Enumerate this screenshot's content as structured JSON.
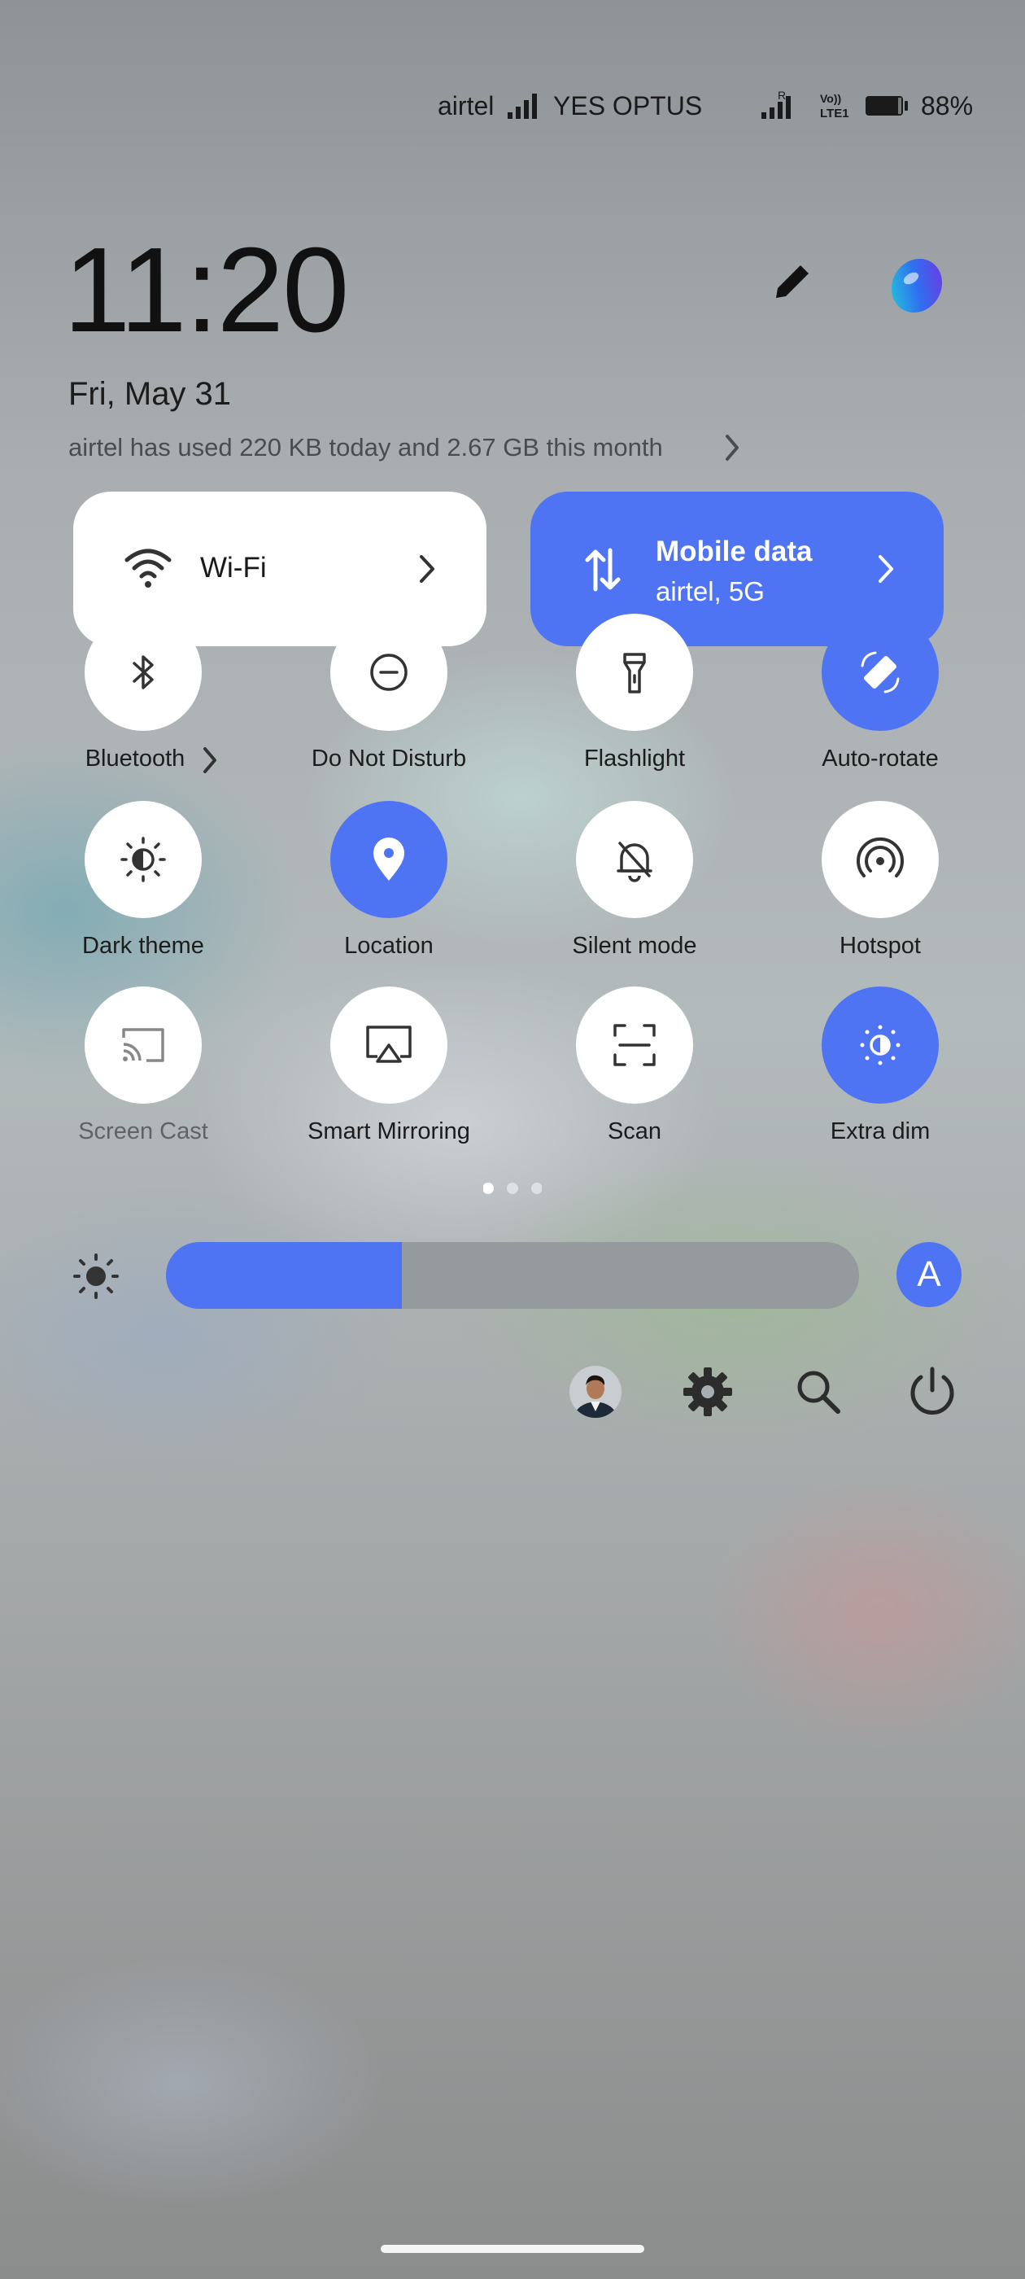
{
  "status_bar": {
    "carrier1": "airtel",
    "carrier2": "YES OPTUS",
    "volte_label": "Vo)) LTE1",
    "roaming": "R",
    "battery": "88%"
  },
  "header": {
    "time": "11:20",
    "date": "Fri, May 31",
    "data_usage": "airtel has used 220 KB today and 2.67 GB this month"
  },
  "big_tiles": {
    "wifi": {
      "label": "Wi-Fi",
      "active": false
    },
    "mobile_data": {
      "label": "Mobile data",
      "sub": "airtel, 5G",
      "active": true
    }
  },
  "tiles": [
    {
      "label": "Bluetooth",
      "icon": "bluetooth-icon",
      "active": false
    },
    {
      "label": "Do Not Disturb",
      "icon": "do-not-disturb-icon",
      "active": false
    },
    {
      "label": "Flashlight",
      "icon": "flashlight-icon",
      "active": false
    },
    {
      "label": "Auto-rotate",
      "icon": "auto-rotate-icon",
      "active": true
    },
    {
      "label": "Dark theme",
      "icon": "dark-theme-icon",
      "active": false
    },
    {
      "label": "Location",
      "icon": "location-icon",
      "active": true
    },
    {
      "label": "Silent mode",
      "icon": "silent-mode-icon",
      "active": false
    },
    {
      "label": "Hotspot",
      "icon": "hotspot-icon",
      "active": false
    },
    {
      "label": "Screen Cast",
      "icon": "screen-cast-icon",
      "active": false
    },
    {
      "label": "Smart Mirroring",
      "icon": "smart-mirroring-icon",
      "active": false
    },
    {
      "label": "Scan",
      "icon": "scan-icon",
      "active": false
    },
    {
      "label": "Extra dim",
      "icon": "extra-dim-icon",
      "active": true
    }
  ],
  "pager": {
    "pages": 3,
    "current": 1
  },
  "brightness": {
    "level_percent": 34,
    "auto_label": "A"
  },
  "colors": {
    "accent": "#4f74f3",
    "tile_bg": "#ffffff"
  }
}
